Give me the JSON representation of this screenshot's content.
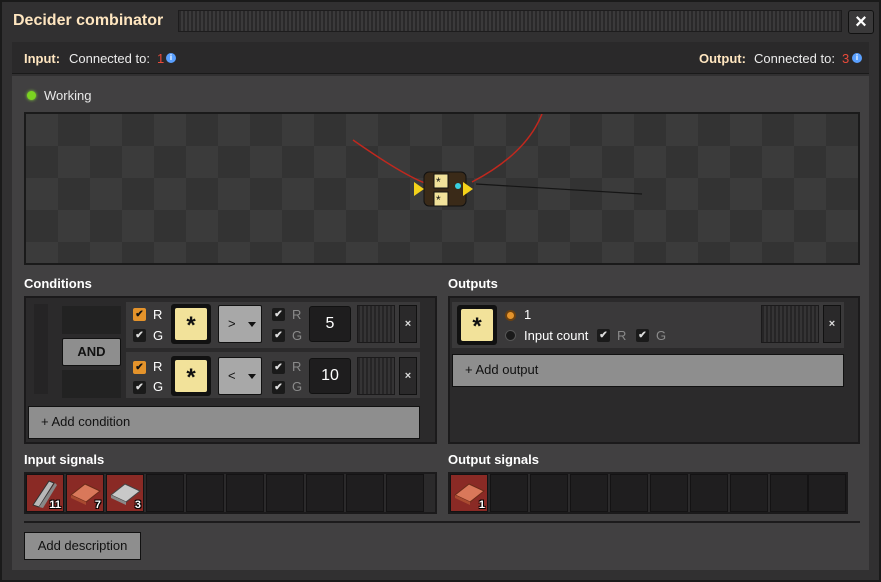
{
  "window": {
    "title": "Decider combinator",
    "close_icon": "close-icon"
  },
  "connections": {
    "input": {
      "label": "Input:",
      "text": "Connected to:",
      "count": "1"
    },
    "output": {
      "label": "Output:",
      "text": "Connected to:",
      "count": "3"
    }
  },
  "status": {
    "text": "Working",
    "color": "#7bd321"
  },
  "conditions": {
    "heading": "Conditions",
    "and_label": "AND",
    "rows": [
      {
        "left_r": "R",
        "left_g": "G",
        "left_r_checked": true,
        "left_g_checked": true,
        "signal": "*",
        "comparator": ">",
        "right_r": "R",
        "right_g": "G",
        "constant": "5",
        "remove": "×"
      },
      {
        "left_r": "R",
        "left_g": "G",
        "left_r_checked": true,
        "left_g_checked": true,
        "signal": "*",
        "comparator": "<",
        "right_r": "R",
        "right_g": "G",
        "constant": "10",
        "remove": "×"
      }
    ],
    "add_label": "+ Add condition"
  },
  "outputs": {
    "heading": "Outputs",
    "row": {
      "signal": "*",
      "value_label": "1",
      "input_count_label": "Input count",
      "r": "R",
      "g": "G",
      "remove": "×"
    },
    "add_label": "+ Add output"
  },
  "input_signals": {
    "heading": "Input signals",
    "items": [
      {
        "icon": "iron-stick-icon",
        "count": "11"
      },
      {
        "icon": "copper-plate-icon",
        "count": "7"
      },
      {
        "icon": "iron-plate-icon",
        "count": "3"
      }
    ]
  },
  "output_signals": {
    "heading": "Output signals",
    "items": [
      {
        "icon": "copper-plate-icon",
        "count": "1"
      }
    ]
  },
  "description_button": "Add description"
}
